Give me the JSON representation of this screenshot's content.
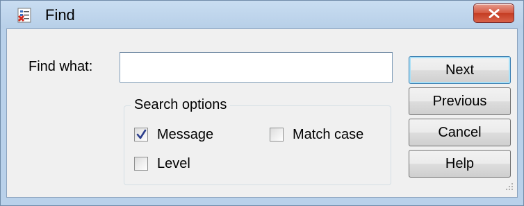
{
  "window": {
    "title": "Find",
    "app_icon": "find-app-icon",
    "close_icon": "close-icon"
  },
  "form": {
    "find_what_label": "Find what:",
    "find_what_value": "",
    "search_options": {
      "legend": "Search options",
      "message": {
        "label": "Message",
        "checked": true
      },
      "match_case": {
        "label": "Match case",
        "checked": false
      },
      "level": {
        "label": "Level",
        "checked": false
      }
    }
  },
  "buttons": {
    "next": "Next",
    "previous": "Previous",
    "cancel": "Cancel",
    "help": "Help"
  },
  "colors": {
    "titlebar": "#c9ddf1",
    "client_bg": "#f0f0f0",
    "close_button": "#c43d23",
    "default_button_border": "#3c7fb1",
    "check_mark": "#2c3e8c"
  }
}
